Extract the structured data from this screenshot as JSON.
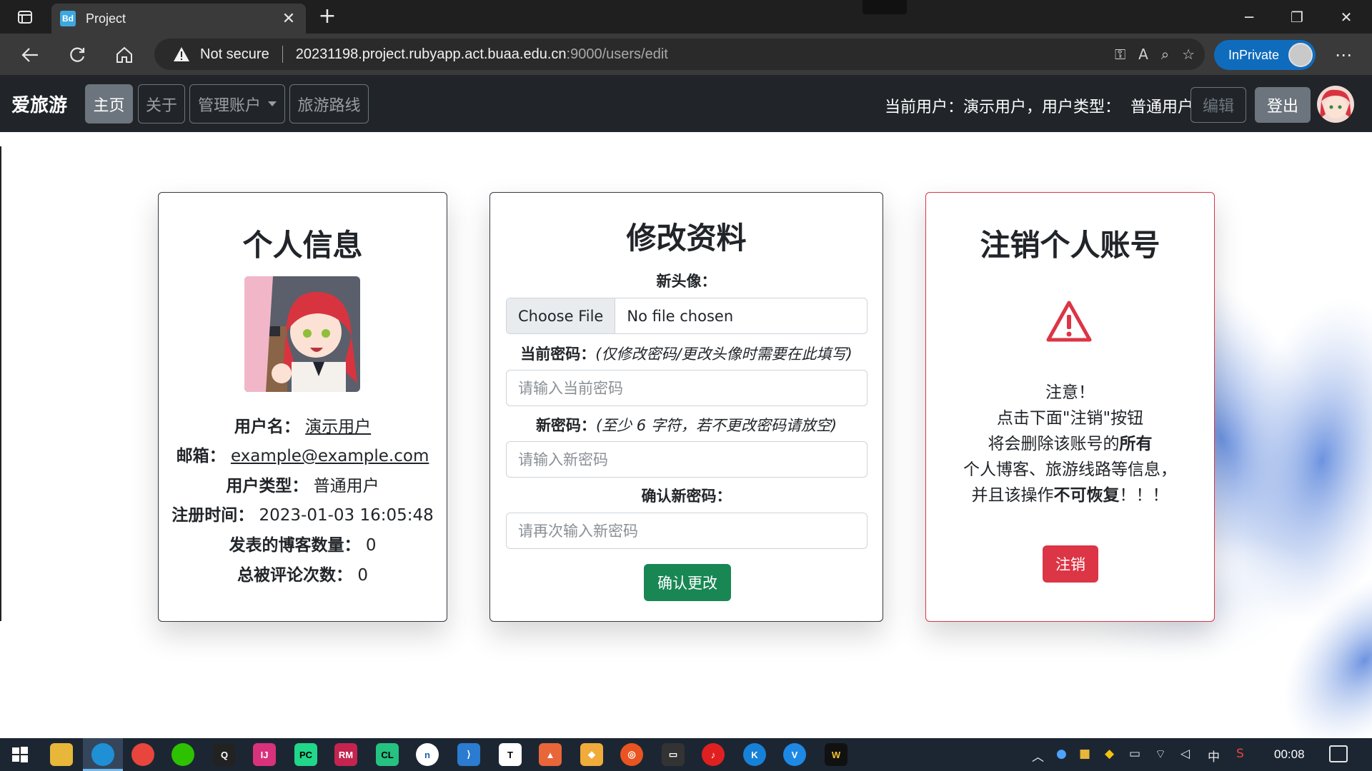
{
  "browser": {
    "tab_title": "Project",
    "tab_favicon": "Bd",
    "not_secure": "Not secure",
    "url_host": "20231198.project.rubyapp.act.buaa.edu.cn",
    "url_rest": ":9000/users/edit",
    "inprivate": "InPrivate"
  },
  "navbar": {
    "brand": "爱旅游",
    "home": "主页",
    "about": "关于",
    "manage": "管理账户",
    "routes": "旅游路线",
    "current_user": "当前用户：演示用户，用户类型：",
    "user_type": "普通用户",
    "edit": "编辑",
    "logout": "登出"
  },
  "profile": {
    "title": "个人信息",
    "username_label": "用户名：",
    "username": "演示用户",
    "email_label": "邮箱：",
    "email": "example@example.com",
    "type_label": "用户类型：",
    "type": "普通用户",
    "registered_label": "注册时间：",
    "registered": "2023-01-03 16:05:48",
    "posts_label": "发表的博客数量：",
    "posts": "0",
    "comments_label": "总被评论次数：",
    "comments": "0"
  },
  "edit": {
    "title": "修改资料",
    "avatar_label": "新头像：",
    "choose_file": "Choose File",
    "no_file": "No file chosen",
    "current_pw_label": "当前密码：",
    "current_pw_hint": "(仅修改密码/更改头像时需要在此填写)",
    "current_pw_placeholder": "请输入当前密码",
    "new_pw_label": "新密码：",
    "new_pw_hint": "(至少 6 字符，若不更改密码请放空)",
    "new_pw_placeholder": "请输入新密码",
    "confirm_pw_label": "确认新密码：",
    "confirm_pw_placeholder": "请再次输入新密码",
    "submit": "确认更改"
  },
  "delete": {
    "title": "注销个人账号",
    "line1": "注意！",
    "line2": "点击下面\"注销\"按钮",
    "line3a": "将会删除该账号的",
    "line3b": "所有",
    "line4": "个人博客、旅游线路等信息，",
    "line5a": "并且该操作",
    "line5b": "不可恢复",
    "line5c": "！！！",
    "button": "注销"
  },
  "taskbar": {
    "time": "00:08",
    "ime": "中"
  },
  "colors": {
    "navbar_bg": "#212529",
    "secondary": "#6c757d",
    "success": "#198754",
    "danger": "#dc3545",
    "inprivate": "#0f6cbd"
  }
}
